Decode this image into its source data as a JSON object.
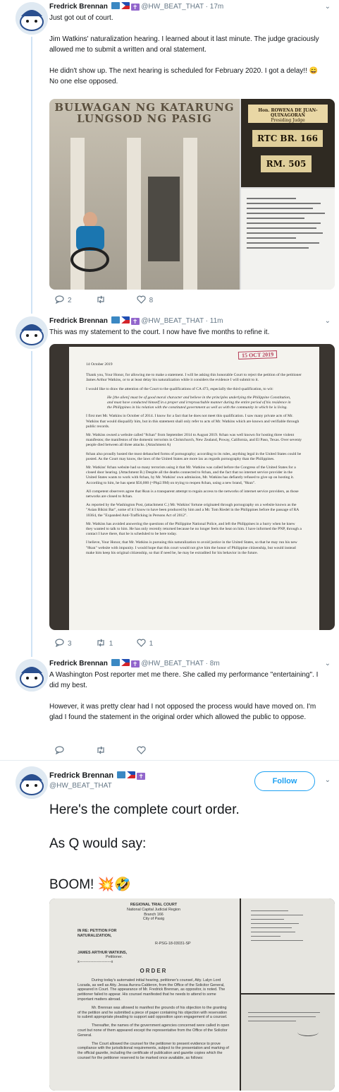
{
  "tweets": [
    {
      "author": "Fredrick Brennan",
      "handle": "@HW_BEAT_THAT",
      "time": "17m",
      "paragraphs": [
        "Just got out of court.",
        "Jim Watkins' naturalization hearing. I learned about it last minute. The judge graciously allowed me to submit a written and oral statement.",
        "He didn't show up. The next hearing is scheduled for February 2020. I got a delay!! 😄 No one else opposed."
      ],
      "media": {
        "building_sign_line1": "BULWAGAN NG KATARUNG",
        "building_sign_line2": "LUNGSOD NG PASIG",
        "plaque1_line1": "Hon. ROWENA DE JUAN-QUINAGORAN",
        "plaque1_line2": "Presiding Judge",
        "plaque2": "RTC BR. 166",
        "plaque3": "RM. 505"
      },
      "actions": {
        "reply": "2",
        "retweet": "",
        "like": "8"
      }
    },
    {
      "author": "Fredrick Brennan",
      "handle": "@HW_BEAT_THAT",
      "time": "11m",
      "paragraphs": [
        "This was my statement to the court. I now have five months to refine it."
      ],
      "media": {
        "stamp": "15 OCT 2019",
        "date": "14 October 2019",
        "doc_paragraphs": [
          "Thank you, Your Honor, for allowing me to make a statement. I will be asking this honorable Court to reject the petition of the petitioner James Arthur Watkins, or to at least delay his naturalization while it considers the evidence I will submit to it.",
          "I would like to draw the attention of the Court to the qualifications of CA 473, especially the third qualification, to wit:",
          "He [the alien] must be of good moral character and believe in the principles underlying the Philippine Constitution, and must have conducted himself in a proper and irreproachable manner during the entire period of his residence in the Philippines in his relation with the constituted government as well as with the community in which he is living.",
          "I first met Mr. Watkins in October of 2014. I know for a fact that he does not meet this qualification. I saw many private acts of Mr. Watkins that would disqualify him, but in this statement shall only refer to acts of Mr. Watkins which are known and verifiable through public records.",
          "Mr. Watkins owned a website called \"8chan\" from September 2014 to August 2019. 8chan was well known for hosting three violent manifestos; the manifestos of the domestic terrorists in Christchurch, New Zealand, Poway, California, and El Paso, Texas. Over seventy people died between all three attacks. (Attachment A)",
          "8chan also proudly hosted the most debauched forms of pornography; according to its rules, anything legal in the United States could be posted. As the Court may know, the laws of the United States are more lax as regards pornography than the Philippines.",
          "Mr. Watkins' 8chan website had so many terrorists using it that Mr. Watkins was called before the Congress of the United States for a closed door hearing. (Attachment B.) Despite all the deaths connected to 8chan, and the fact that no internet service provider in the United States wants to work with 8chan, by Mr. Watkins' own admission, Mr. Watkins has defiantly refused to give up on hosting it. According to him, he has spent $56,000 (=Php2.9M) on trying to reopen 8chan, using a new brand, \"8kun\".",
          "All competent observers agree that 8kun is a transparent attempt to regain access to the networks of internet service providers, as those networks are closed to 8chan.",
          "As reported by the Washington Post, (attachment C.) Mr. Watkins' fortune originated through pornography on a website known as the \"Asian Bikini Bar\", some of it I know to have been produced by him and a Mr. Tom Riedel in the Philippines before the passage of RA 10364, the \"Expanded Anti-Trafficking in Persons Act of 2012\".",
          "Mr. Watkins has avoided answering the questions of the Philippine National Police, and left the Philippines in a hurry when he knew they wanted to talk to him. He has only recently returned because he no longer feels the heat on him. I have informed the PNP, through a contact I have there, that he is scheduled to be here today.",
          "I believe, Your Honor, that Mr. Watkins is pursuing this naturalization to avoid justice in the United States, so that he may run his new \"8kun\" website with impunity. I would hope that this court would not give him the honor of Philippine citizenship, but would instead make him keep his original citizenship, so that if need be, he may be extradited for his behavior in the future."
        ]
      },
      "actions": {
        "reply": "3",
        "retweet": "1",
        "like": "1"
      }
    },
    {
      "author": "Fredrick Brennan",
      "handle": "@HW_BEAT_THAT",
      "time": "8m",
      "paragraphs": [
        "A Washington Post reporter met me there. She called my performance \"entertaining\". I did my best.",
        "However, it was pretty clear had I not opposed the process would have moved on. I'm glad I found the statement in the original order which allowed the public to oppose."
      ],
      "actions": {
        "reply": "",
        "retweet": "",
        "like": ""
      }
    },
    {
      "author": "Fredrick Brennan",
      "handle": "@HW_BEAT_THAT",
      "follow_label": "Follow",
      "lines": [
        "Here's the complete court order.",
        "As Q would say:",
        "BOOM! 💥🤣"
      ],
      "media": {
        "court": "REGIONAL TRIAL COURT",
        "region": "National Capital Judicial Region",
        "branch": "Branch 166",
        "city": "City of Pasig",
        "in_re": "IN RE: PETITION FOR NATURALIZATION,",
        "case_no": "R-PSG-18-03031-SP",
        "party": "JAMES ARTHUR WATKINS,",
        "party_role": "Petitioner.",
        "dashes": "x-------------------------x",
        "order_title": "ORDER",
        "paragraphs": [
          "During today's automated initial hearing, petitioner's counsel, Atty. Lalyn Lord Lozada, as well as Atty. Jessa Aurora-Calderon, from the Office of the Solicitor General, appeared in Court. The appearance of Mr. Fredrick Brennan, as oppositor, is noted. The petitioner failed to appear. His counsel manifested that he needs to attend to some important matters abroad.",
          "Mr. Brennan was allowed to manifest the grounds of his objection to the granting of the petition and he submitted a piece of paper containing his objection with reservation to submit appropriate pleading to support said opposition upon engagement of a counsel.",
          "Thereafter, the names of the government agencies concerned were called in open court but none of them appeared except the representative from the Office of the Solicitor General.",
          "The Court allowed the counsel for the petitioner to present evidence to prove compliance with the jurisdictional requirements, subject to the presentation and marking of the official gazette, including the certificate of publication and gazette copies which the counsel for the petitioner reserved to be marked once available, as follows:"
        ]
      }
    }
  ],
  "colors": {
    "link_blue": "#1da1f2",
    "text": "#14171a",
    "muted": "#657786",
    "thread": "#cfe3f5"
  }
}
